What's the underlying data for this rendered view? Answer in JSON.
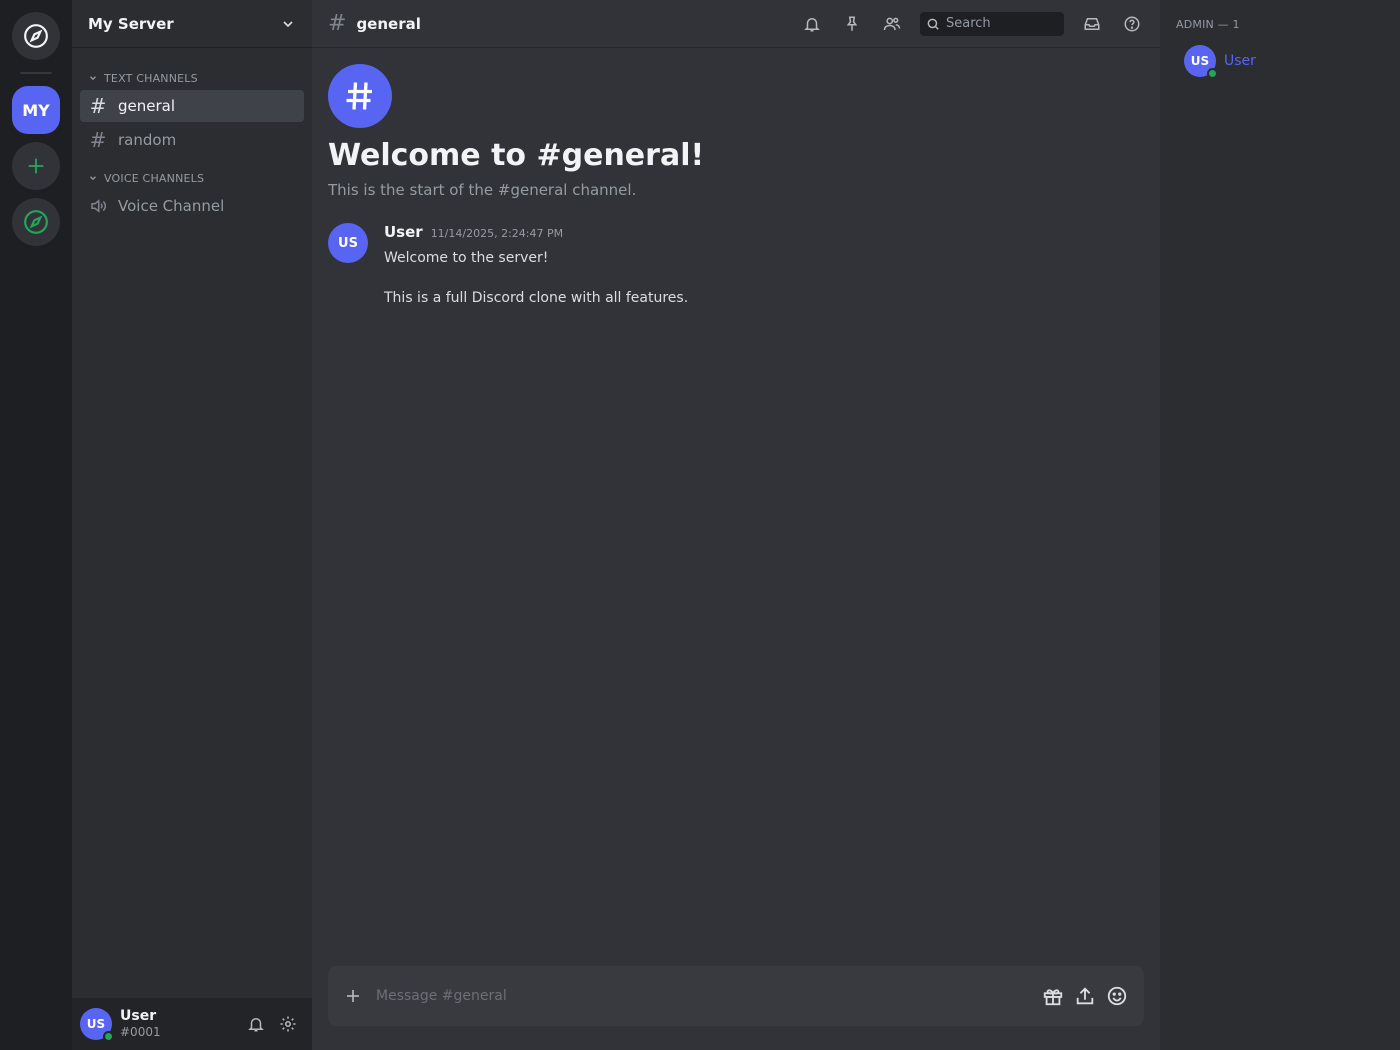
{
  "rail": {
    "server_initials": "MY"
  },
  "sidebar": {
    "server_name": "My Server",
    "categories": [
      {
        "label": "Text Channels",
        "channels": [
          "general",
          "random"
        ]
      },
      {
        "label": "Voice Channels",
        "channels": [
          "Voice Channel"
        ]
      }
    ],
    "active_channel": "general"
  },
  "user_panel": {
    "initials": "US",
    "name": "User",
    "tag": "#0001"
  },
  "topbar": {
    "channel": "general",
    "search_placeholder": "Search"
  },
  "main": {
    "welcome_title": "Welcome to #general!",
    "welcome_sub": "This is the start of the #general channel.",
    "message": {
      "initials": "US",
      "author": "User",
      "timestamp": "11/14/2025, 2:24:47 PM",
      "lines": [
        "Welcome to the server!",
        "This is a full Discord clone with all features."
      ]
    }
  },
  "composer": {
    "placeholder": "Message #general"
  },
  "members": {
    "heading": "Admin — 1",
    "list": [
      {
        "initials": "US",
        "name": "User"
      }
    ]
  },
  "colors": {
    "accent": "#5865f2",
    "online": "#23a55a",
    "green_icon": "#23a55a"
  }
}
